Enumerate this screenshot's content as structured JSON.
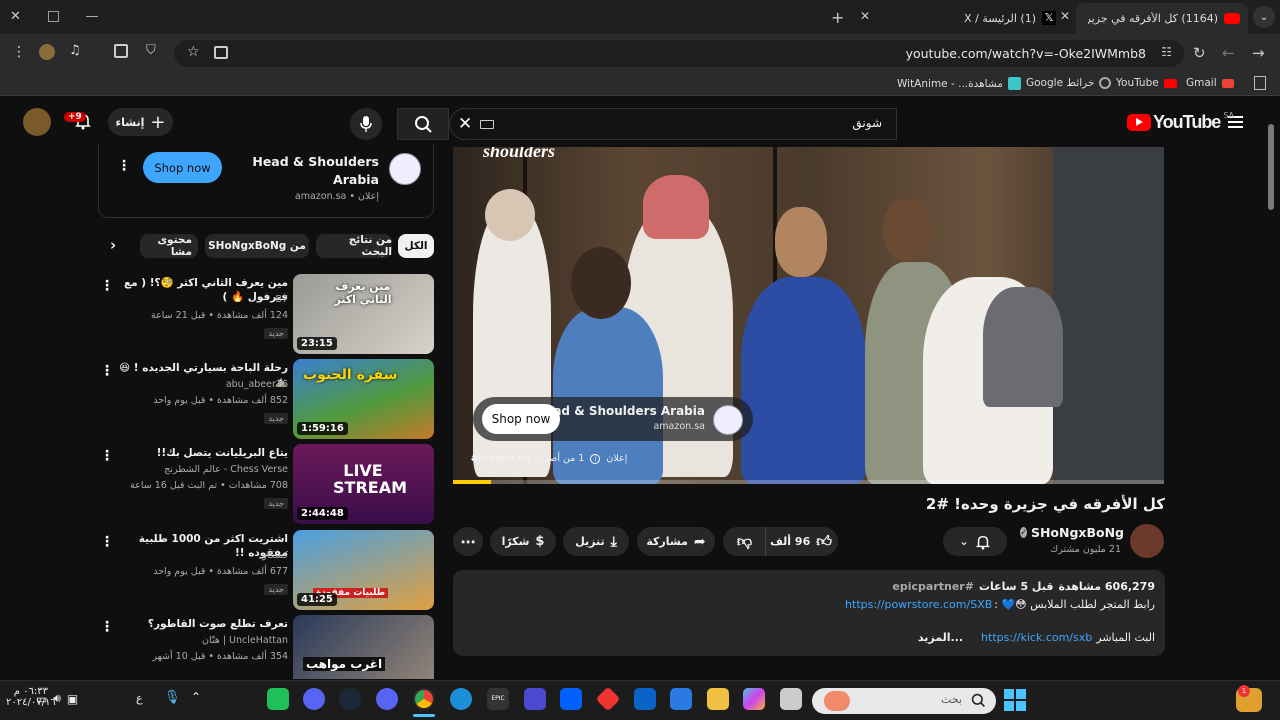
{
  "browser": {
    "tabs": [
      {
        "label": "(1164) كل الأفرقه في جزيرة وحده"
      },
      {
        "label": "(1) الرئيسة / X"
      }
    ],
    "url": "youtube.com/watch?v=-Oke2IWMmb8",
    "bookmarks": [
      "Gmail",
      "YouTube",
      "خرائط Google",
      "مشاهدة... - WitAnime"
    ]
  },
  "yt": {
    "logo_text": "YouTube",
    "region": "SA",
    "search_value": "شونق",
    "create_label": "إنشاء",
    "notif_count": "+9"
  },
  "player_ad": {
    "brand": "Head & Shoulders Arabia",
    "domain": "amazon.sa",
    "shop_label": "Shop now",
    "ad_badge": "إعلان",
    "ad_counter": "1 من أصل 2",
    "logo_text": "shoulders"
  },
  "video": {
    "title": "كل الأفرقه في جزيرة وحده! #2",
    "channel": "SHoNgxBoNg",
    "subscribers": "21 مليون مشترك",
    "likes": "96 ألف",
    "share_label": "مشاركة",
    "download_label": "تنزيل",
    "thanks_label": "شكرًا"
  },
  "description": {
    "views": "606,279 مشاهدة",
    "age": "قبل 5 ساعات",
    "hashtag": "#epicpartner",
    "line1_text": "رابط المتجر لطلب الملابس 😳💙 :",
    "line1_link": "https://powrstore.com/SXB",
    "line2_text": "البث المباشر",
    "line2_link": "https://kick.com/sxb",
    "more_label": "...المزيد"
  },
  "sidebar_ad": {
    "brand_line1": "Head & Shoulders",
    "brand_line2": "Arabia",
    "sub": "إعلان • amazon.sa",
    "shop_label": "Shop now"
  },
  "chips": [
    "الكل",
    "من نتائج البحث",
    "من SHoNgxBoNg",
    "محتوى مشا"
  ],
  "recommended": [
    {
      "title": "مين يعرف الثاني اكثر 🧐؟! ( مع فيرفول 🔥 )",
      "channel": "B7",
      "meta": "124 ألف مشاهدة • قبل 21 ساعة",
      "badge": "جديد",
      "duration": "23:15",
      "thumb_text": "مين يعرف الثاني اكثر"
    },
    {
      "title": "رحلة الباحة بسيارتي الجديده ! 😆 ⛰️",
      "channel": "abu_abeer16",
      "meta": "852 ألف مشاهدة • قبل يوم واحد",
      "badge": "جديد",
      "duration": "1:59:16",
      "thumb_text": "سفرة الجنوب"
    },
    {
      "title": "يتاع البريليانت يتصل بك!!",
      "channel": "Chess Verse - عالم الشطرنج",
      "meta": "708 مشاهدات • تم البث قبل 16 ساعة",
      "badge": "جديد",
      "duration": "2:44:48",
      "thumb_text": "LIVE STREAM"
    },
    {
      "title": "اشتريت اكثر من 1000 طلبية مفقوده !!",
      "channel": "كسكاو",
      "meta": "677 ألف مشاهدة • قبل يوم واحد",
      "badge": "جديد",
      "duration": "41:25",
      "thumb_text": "طلبيات مفقودة"
    },
    {
      "title": "تعرف تطلع صوت القاطور؟",
      "channel": "UncleHattan | هتّان",
      "meta": "354 ألف مشاهدة • قبل 10 أشهر",
      "badge": "",
      "duration": "",
      "thumb_text": "اغرب مواهب"
    }
  ],
  "taskbar": {
    "search_placeholder": "بحث",
    "time": "٠٦:٣٣ م",
    "date": "٢٠٢٤/٠٧/١٦",
    "lang": "ع"
  }
}
